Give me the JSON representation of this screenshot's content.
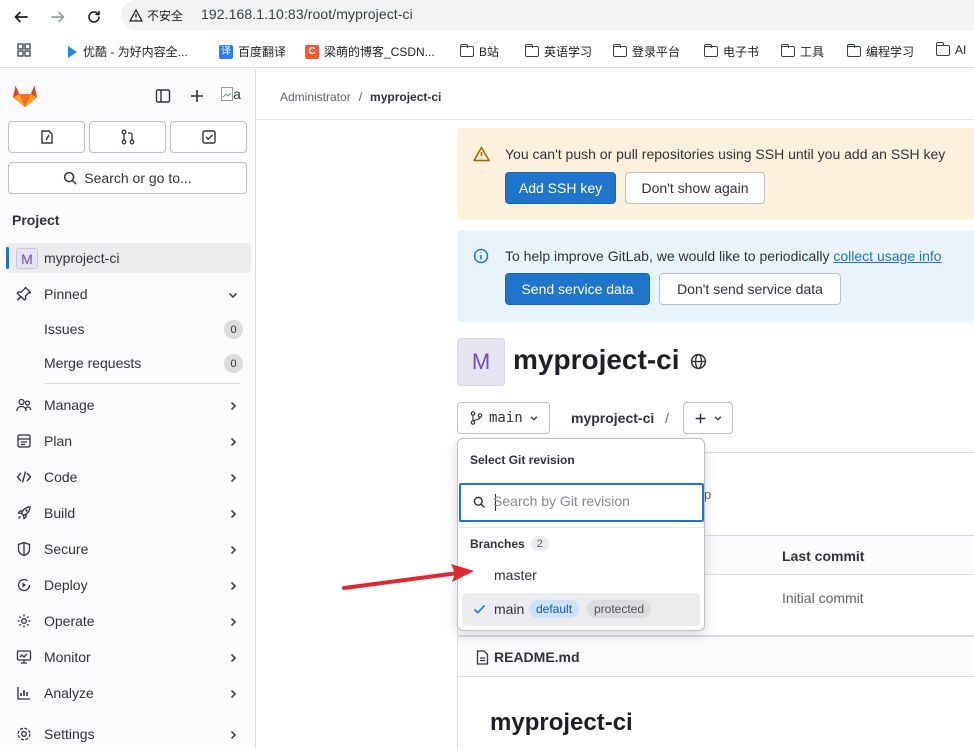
{
  "browser": {
    "security_label": "不安全",
    "url": "192.168.1.10:83/root/myproject-ci",
    "bookmarks": [
      "优酷 - 为好内容全...",
      "百度翻译",
      "梁萌的博客_CSDN...",
      "B站",
      "英语学习",
      "登录平台",
      "电子书",
      "工具",
      "编程学习",
      "AI"
    ]
  },
  "sidebar": {
    "avatar_alt": "a",
    "heading": "Project",
    "search_label": "Search or go to...",
    "project_initial": "M",
    "project_name": "myproject-ci",
    "pinned_label": "Pinned",
    "pinned_items": [
      {
        "label": "Issues",
        "count": "0"
      },
      {
        "label": "Merge requests",
        "count": "0"
      }
    ],
    "nav": [
      "Manage",
      "Plan",
      "Code",
      "Build",
      "Secure",
      "Deploy",
      "Operate",
      "Monitor",
      "Analyze",
      "Settings"
    ]
  },
  "breadcrumb": {
    "parent": "Administrator",
    "sep": "/",
    "current": "myproject-ci"
  },
  "ssh_alert": {
    "text": "You can't push or pull repositories using SSH until you add an SSH key",
    "primary": "Add SSH key",
    "secondary": "Don't show again"
  },
  "usage_alert": {
    "text": "To help improve GitLab, we would like to periodically ",
    "link": "collect usage info",
    "primary": "Send service data",
    "secondary": "Don't send service data"
  },
  "project": {
    "initial": "M",
    "title": "myproject-ci"
  },
  "repo_bar": {
    "branch": "main",
    "path": "myproject-ci",
    "slash": "/"
  },
  "table": {
    "col_last_commit": "Last commit",
    "commit_message": "Initial commit",
    "partial_text": "p"
  },
  "readme": {
    "file_name": "README.md",
    "heading": "myproject-ci"
  },
  "dropdown": {
    "title": "Select Git revision",
    "search_placeholder": "Search by Git revision",
    "group_label": "Branches",
    "group_count": "2",
    "branches": [
      {
        "name": "master"
      },
      {
        "name": "main",
        "badges": [
          "default",
          "protected"
        ]
      }
    ]
  },
  "colors": {
    "accent": "#1f75cb",
    "warning_bg": "#fdf1dd",
    "info_bg": "#e9f3fc",
    "annotation_arrow": "#e0282e"
  }
}
